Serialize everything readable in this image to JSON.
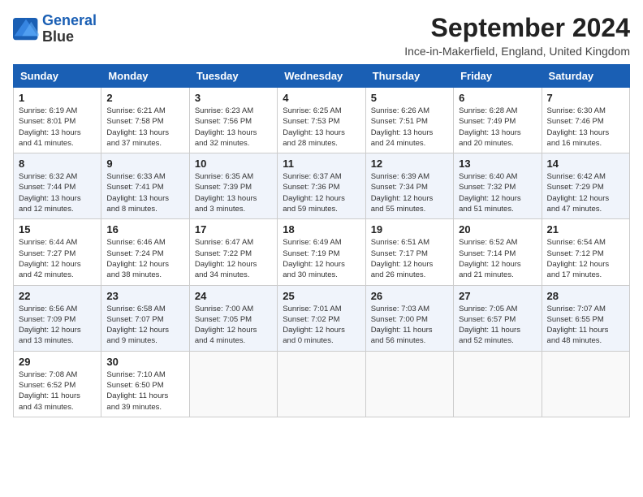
{
  "logo": {
    "line1": "General",
    "line2": "Blue"
  },
  "title": "September 2024",
  "subtitle": "Ince-in-Makerfield, England, United Kingdom",
  "weekdays": [
    "Sunday",
    "Monday",
    "Tuesday",
    "Wednesday",
    "Thursday",
    "Friday",
    "Saturday"
  ],
  "weeks": [
    [
      {
        "day": "1",
        "info": "Sunrise: 6:19 AM\nSunset: 8:01 PM\nDaylight: 13 hours\nand 41 minutes."
      },
      {
        "day": "2",
        "info": "Sunrise: 6:21 AM\nSunset: 7:58 PM\nDaylight: 13 hours\nand 37 minutes."
      },
      {
        "day": "3",
        "info": "Sunrise: 6:23 AM\nSunset: 7:56 PM\nDaylight: 13 hours\nand 32 minutes."
      },
      {
        "day": "4",
        "info": "Sunrise: 6:25 AM\nSunset: 7:53 PM\nDaylight: 13 hours\nand 28 minutes."
      },
      {
        "day": "5",
        "info": "Sunrise: 6:26 AM\nSunset: 7:51 PM\nDaylight: 13 hours\nand 24 minutes."
      },
      {
        "day": "6",
        "info": "Sunrise: 6:28 AM\nSunset: 7:49 PM\nDaylight: 13 hours\nand 20 minutes."
      },
      {
        "day": "7",
        "info": "Sunrise: 6:30 AM\nSunset: 7:46 PM\nDaylight: 13 hours\nand 16 minutes."
      }
    ],
    [
      {
        "day": "8",
        "info": "Sunrise: 6:32 AM\nSunset: 7:44 PM\nDaylight: 13 hours\nand 12 minutes."
      },
      {
        "day": "9",
        "info": "Sunrise: 6:33 AM\nSunset: 7:41 PM\nDaylight: 13 hours\nand 8 minutes."
      },
      {
        "day": "10",
        "info": "Sunrise: 6:35 AM\nSunset: 7:39 PM\nDaylight: 13 hours\nand 3 minutes."
      },
      {
        "day": "11",
        "info": "Sunrise: 6:37 AM\nSunset: 7:36 PM\nDaylight: 12 hours\nand 59 minutes."
      },
      {
        "day": "12",
        "info": "Sunrise: 6:39 AM\nSunset: 7:34 PM\nDaylight: 12 hours\nand 55 minutes."
      },
      {
        "day": "13",
        "info": "Sunrise: 6:40 AM\nSunset: 7:32 PM\nDaylight: 12 hours\nand 51 minutes."
      },
      {
        "day": "14",
        "info": "Sunrise: 6:42 AM\nSunset: 7:29 PM\nDaylight: 12 hours\nand 47 minutes."
      }
    ],
    [
      {
        "day": "15",
        "info": "Sunrise: 6:44 AM\nSunset: 7:27 PM\nDaylight: 12 hours\nand 42 minutes."
      },
      {
        "day": "16",
        "info": "Sunrise: 6:46 AM\nSunset: 7:24 PM\nDaylight: 12 hours\nand 38 minutes."
      },
      {
        "day": "17",
        "info": "Sunrise: 6:47 AM\nSunset: 7:22 PM\nDaylight: 12 hours\nand 34 minutes."
      },
      {
        "day": "18",
        "info": "Sunrise: 6:49 AM\nSunset: 7:19 PM\nDaylight: 12 hours\nand 30 minutes."
      },
      {
        "day": "19",
        "info": "Sunrise: 6:51 AM\nSunset: 7:17 PM\nDaylight: 12 hours\nand 26 minutes."
      },
      {
        "day": "20",
        "info": "Sunrise: 6:52 AM\nSunset: 7:14 PM\nDaylight: 12 hours\nand 21 minutes."
      },
      {
        "day": "21",
        "info": "Sunrise: 6:54 AM\nSunset: 7:12 PM\nDaylight: 12 hours\nand 17 minutes."
      }
    ],
    [
      {
        "day": "22",
        "info": "Sunrise: 6:56 AM\nSunset: 7:09 PM\nDaylight: 12 hours\nand 13 minutes."
      },
      {
        "day": "23",
        "info": "Sunrise: 6:58 AM\nSunset: 7:07 PM\nDaylight: 12 hours\nand 9 minutes."
      },
      {
        "day": "24",
        "info": "Sunrise: 7:00 AM\nSunset: 7:05 PM\nDaylight: 12 hours\nand 4 minutes."
      },
      {
        "day": "25",
        "info": "Sunrise: 7:01 AM\nSunset: 7:02 PM\nDaylight: 12 hours\nand 0 minutes."
      },
      {
        "day": "26",
        "info": "Sunrise: 7:03 AM\nSunset: 7:00 PM\nDaylight: 11 hours\nand 56 minutes."
      },
      {
        "day": "27",
        "info": "Sunrise: 7:05 AM\nSunset: 6:57 PM\nDaylight: 11 hours\nand 52 minutes."
      },
      {
        "day": "28",
        "info": "Sunrise: 7:07 AM\nSunset: 6:55 PM\nDaylight: 11 hours\nand 48 minutes."
      }
    ],
    [
      {
        "day": "29",
        "info": "Sunrise: 7:08 AM\nSunset: 6:52 PM\nDaylight: 11 hours\nand 43 minutes."
      },
      {
        "day": "30",
        "info": "Sunrise: 7:10 AM\nSunset: 6:50 PM\nDaylight: 11 hours\nand 39 minutes."
      },
      {
        "day": "",
        "info": ""
      },
      {
        "day": "",
        "info": ""
      },
      {
        "day": "",
        "info": ""
      },
      {
        "day": "",
        "info": ""
      },
      {
        "day": "",
        "info": ""
      }
    ]
  ]
}
